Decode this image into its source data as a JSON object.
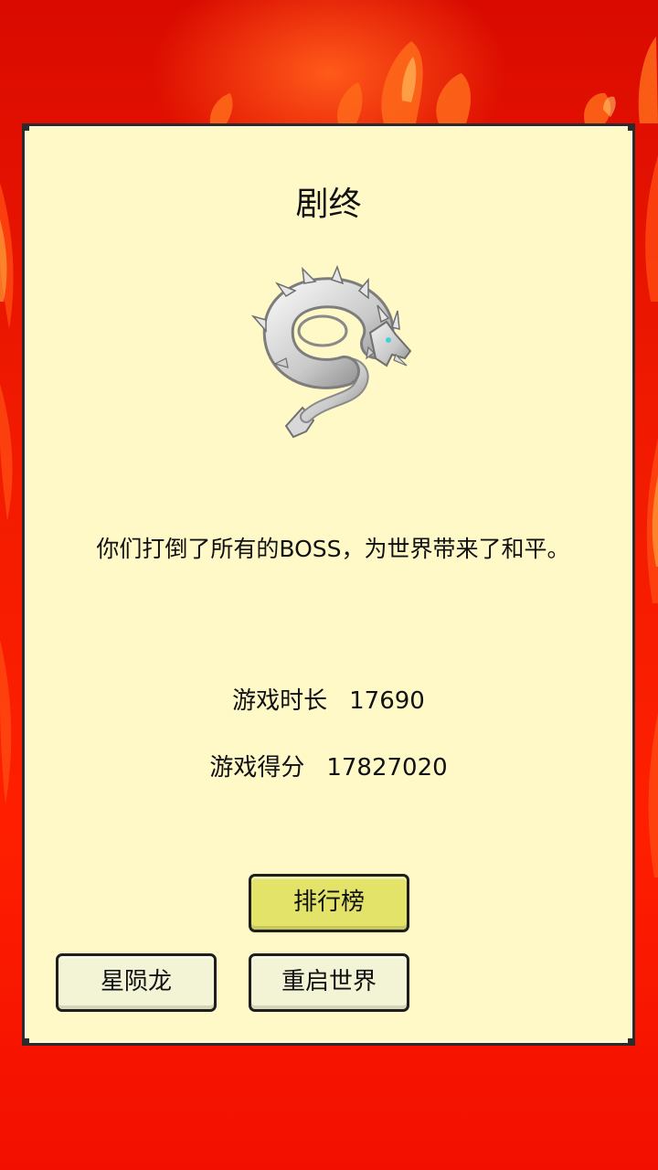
{
  "dialog": {
    "title": "剧终",
    "message": "你们打倒了所有的BOSS，为世界带来了和平。",
    "stats": [
      {
        "label": "游戏时长",
        "value": "17690"
      },
      {
        "label": "游戏得分",
        "value": "17827020"
      }
    ]
  },
  "buttons": {
    "leaderboard": "排行榜",
    "star_dragon": "星陨龙",
    "restart_world": "重启世界"
  },
  "colors": {
    "background": "#e60d00",
    "panel": "#fff9c8",
    "primary_button": "#e3e36a",
    "secondary_button": "#f3f3d6"
  },
  "icons": {
    "hero_image": "white-dragon-icon"
  }
}
